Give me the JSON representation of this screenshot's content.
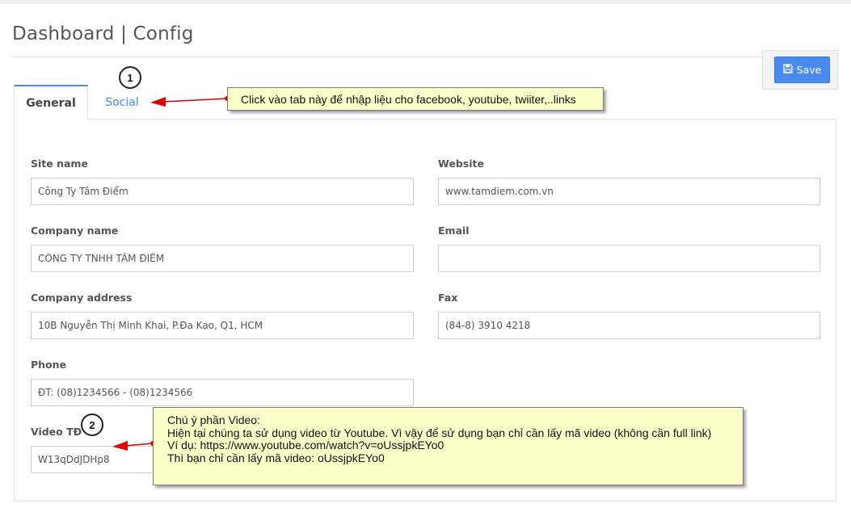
{
  "header": {
    "title": "Dashboard | Config"
  },
  "toolbar": {
    "save_label": "Save"
  },
  "tabs": [
    {
      "label": "General",
      "active": true
    },
    {
      "label": "Social",
      "active": false
    }
  ],
  "form": {
    "site_name": {
      "label": "Site name",
      "value": "Công Ty Tâm Điểm"
    },
    "website": {
      "label": "Website",
      "value": "www.tamdiem.com.vn"
    },
    "company_name": {
      "label": "Company name",
      "value": "CÔNG TY TNHH TÂM ĐIỂM"
    },
    "email": {
      "label": "Email",
      "value": ""
    },
    "company_address": {
      "label": "Company address",
      "value": "10B Nguyễn Thị Minh Khai, P.Đa Kao, Q1, HCM"
    },
    "fax": {
      "label": "Fax",
      "value": "(84-8) 3910 4218"
    },
    "phone": {
      "label": "Phone",
      "value": "ĐT: (08)1234566 - (08)1234566"
    },
    "video": {
      "label": "Video TĐ",
      "value": "W13qDdJDHp8"
    }
  },
  "annotations": {
    "marker_1": "1",
    "marker_2": "2",
    "callout_1": "Click vào tab này để nhập liệu cho facebook, youtube, twiiter,..links",
    "callout_2": [
      "Chú ý phần Video:",
      "Hiện tại chúng ta sử dụng video từ Youtube. Vì vậy để sử dụng bạn chỉ cần lấy mã video (không cần full link)",
      "Ví dụ: https://www.youtube.com/watch?v=oUssjpkEYo0",
      "Thì bạn chỉ cần lấy mã video: oUssjpkEYo0"
    ]
  },
  "colors": {
    "accent": "#4a8bf0",
    "callout_bg": "#fefecb",
    "arrow": "#dd0000"
  },
  "icons": {
    "save": "floppy-disk-icon"
  }
}
